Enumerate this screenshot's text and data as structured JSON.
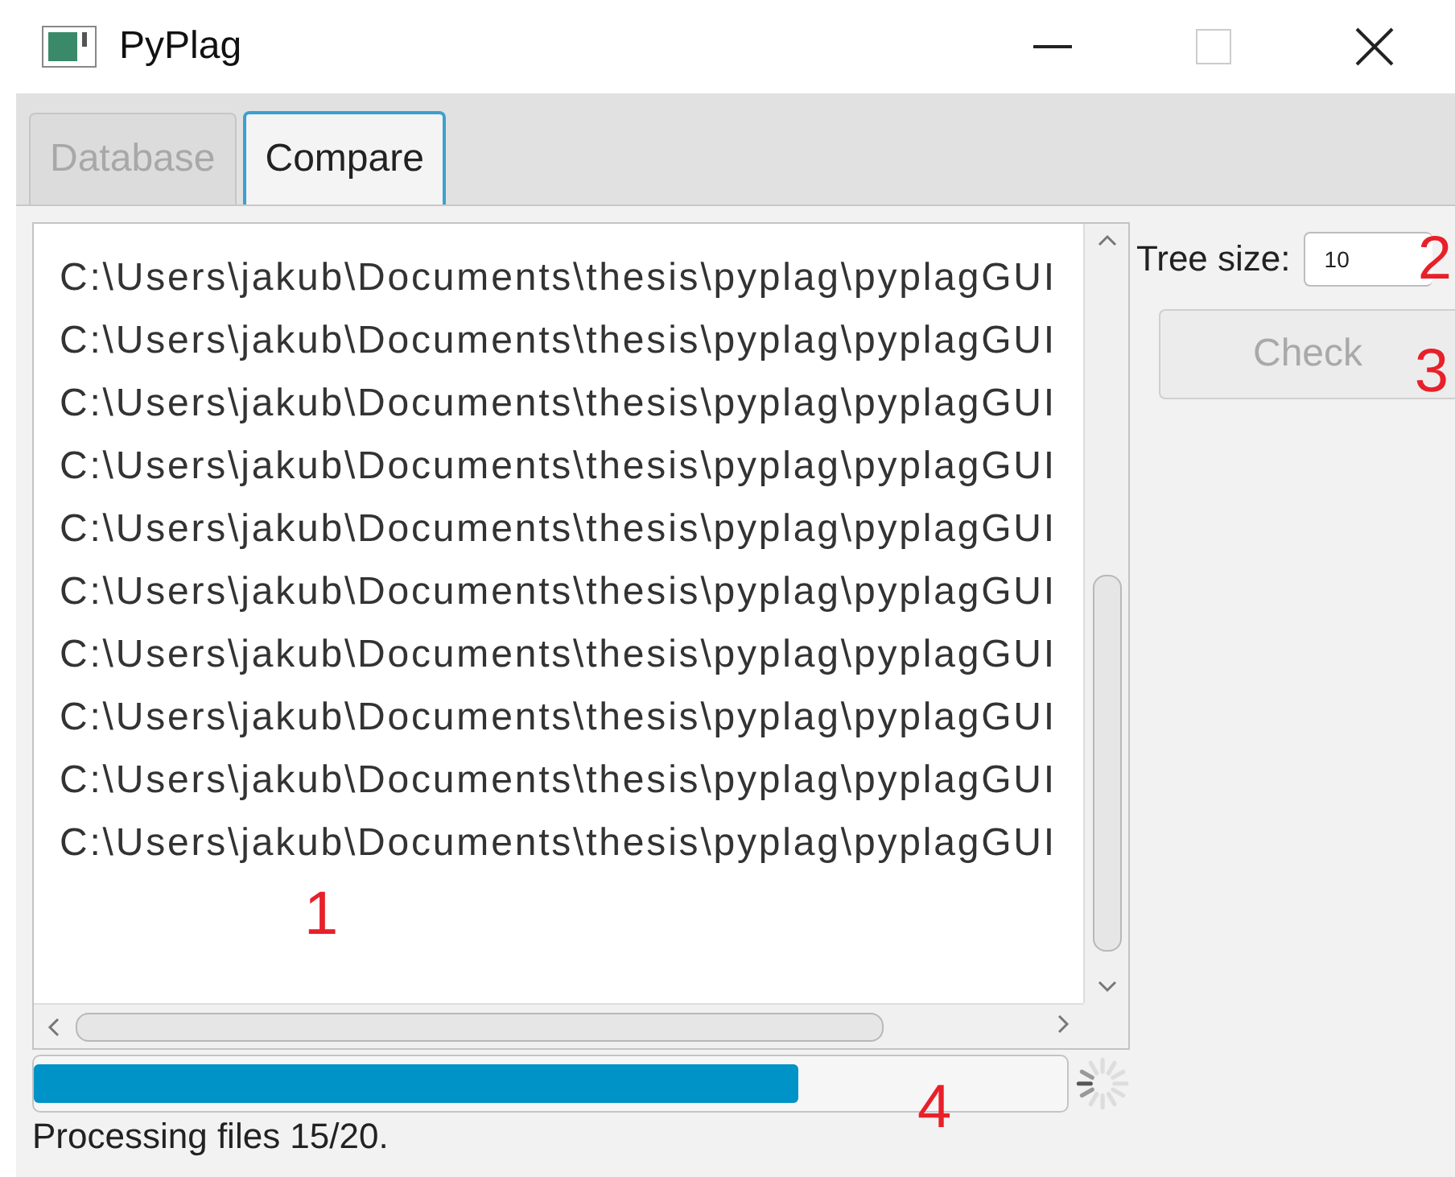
{
  "window": {
    "title": "PyPlag"
  },
  "tabs": [
    {
      "label": "Database",
      "selected": false,
      "disabled": true
    },
    {
      "label": "Compare",
      "selected": true,
      "disabled": false
    }
  ],
  "file_list": {
    "items": [
      "C:\\Users\\jakub\\Documents\\thesis\\pyplag\\pyplagGUI",
      "C:\\Users\\jakub\\Documents\\thesis\\pyplag\\pyplagGUI",
      "C:\\Users\\jakub\\Documents\\thesis\\pyplag\\pyplagGUI",
      "C:\\Users\\jakub\\Documents\\thesis\\pyplag\\pyplagGUI",
      "C:\\Users\\jakub\\Documents\\thesis\\pyplag\\pyplagGUI",
      "C:\\Users\\jakub\\Documents\\thesis\\pyplag\\pyplagGUI",
      "C:\\Users\\jakub\\Documents\\thesis\\pyplag\\pyplagGUI",
      "C:\\Users\\jakub\\Documents\\thesis\\pyplag\\pyplagGUI",
      "C:\\Users\\jakub\\Documents\\thesis\\pyplag\\pyplagGUI",
      "C:\\Users\\jakub\\Documents\\thesis\\pyplag\\pyplagGUI"
    ],
    "annotation": "1"
  },
  "tree_size": {
    "label": "Tree size:",
    "value": "10",
    "annotation": "2"
  },
  "check_button": {
    "label": "Check",
    "disabled": true,
    "annotation": "3"
  },
  "progress": {
    "level": 0.74,
    "annotation": "4"
  },
  "status": "Processing files 15/20."
}
